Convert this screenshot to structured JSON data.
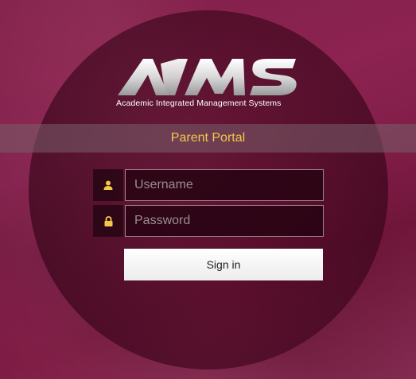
{
  "brand": {
    "logo_text": "AIMS",
    "tagline": "Academic Integrated Management Systems"
  },
  "portal": {
    "title": "Parent Portal"
  },
  "login": {
    "username": {
      "placeholder": "Username",
      "value": "",
      "icon": "user-icon"
    },
    "password": {
      "placeholder": "Password",
      "value": "",
      "icon": "lock-icon"
    },
    "signin_label": "Sign in"
  },
  "colors": {
    "background": "#7c1d45",
    "portal_title": "#f2c84b",
    "icon_gold": "#f2c84b",
    "button": "#ffffff"
  }
}
